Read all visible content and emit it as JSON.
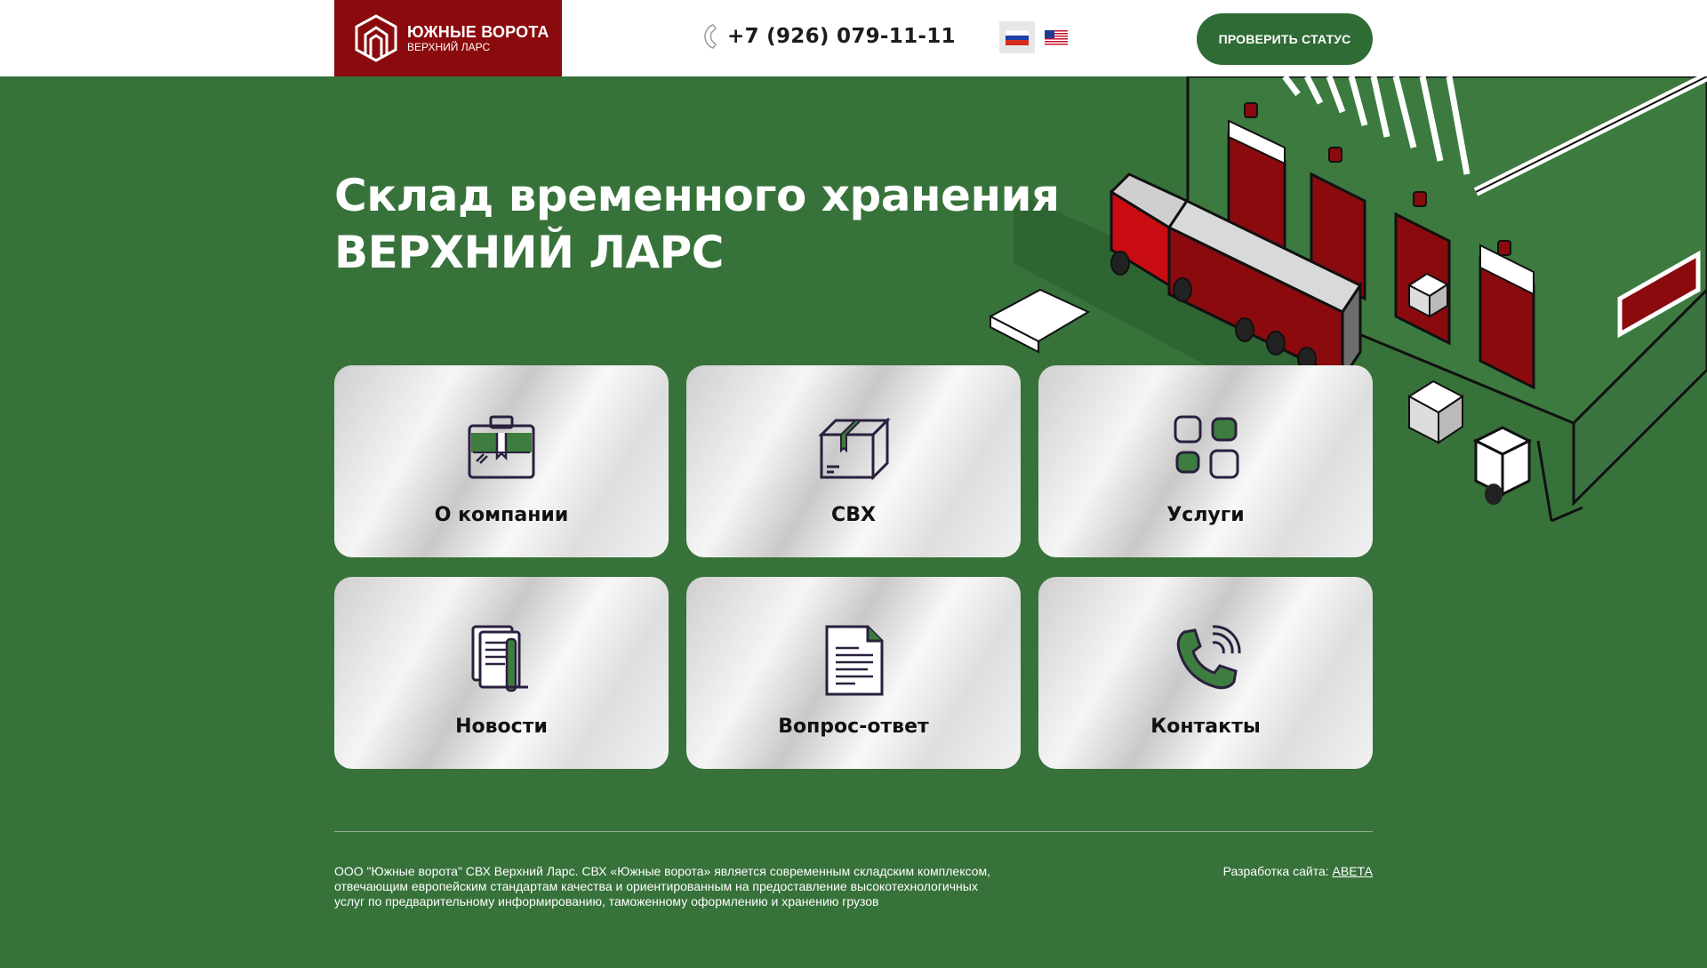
{
  "header": {
    "logo_title": "ЮЖНЫЕ ВОРОТА",
    "logo_subtitle": "ВЕРХНИЙ ЛАРС",
    "phone": "+7 (926) 079-11-11",
    "languages": [
      {
        "code": "ru",
        "icon": "russia-flag-icon",
        "active": true
      },
      {
        "code": "en",
        "icon": "usa-flag-icon",
        "active": false
      }
    ],
    "status_button": "ПРОВЕРИТЬ СТАТУС"
  },
  "hero": {
    "title_line1": "Склад временного хранения",
    "title_line2": "ВЕРХНИЙ ЛАРС"
  },
  "cards": [
    {
      "label": "О компании",
      "icon": "briefcase-icon"
    },
    {
      "label": "СВХ",
      "icon": "box-icon"
    },
    {
      "label": "Услуги",
      "icon": "grid-icon"
    },
    {
      "label": "Новости",
      "icon": "news-icon"
    },
    {
      "label": "Вопрос-ответ",
      "icon": "document-icon"
    },
    {
      "label": "Контакты",
      "icon": "phone-call-icon"
    }
  ],
  "footer": {
    "description": "ООО \"Южные ворота\" СВХ Верхний Ларс. СВХ «Южные ворота» является современным складским комплексом, отвечающим европейским стандартам качества и ориентированным на предоставление высокотехнологичных услуг по предварительному информированию, таможенному оформлению и хранению грузов",
    "dev_label": "Разработка сайта:",
    "dev_link": "АВЕТА"
  },
  "colors": {
    "background": "#37723b",
    "logo_bg": "#8b0a0d",
    "button": "#2f6b35",
    "accent_green": "#3d7d3f",
    "icon_stroke": "#2a1f3d"
  }
}
